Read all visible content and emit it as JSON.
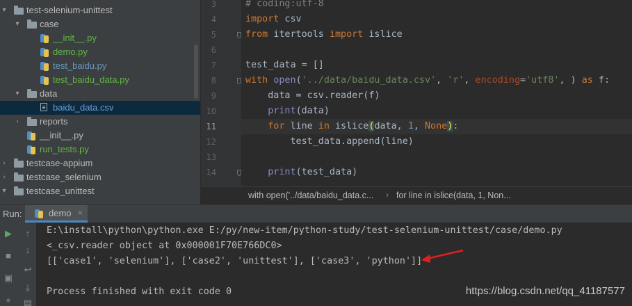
{
  "project_tree": [
    {
      "label": "test-selenium-unittest",
      "kind": "folder",
      "depth": 0,
      "expanded": true
    },
    {
      "label": "case",
      "kind": "folder",
      "depth": 1,
      "expanded": true
    },
    {
      "label": "__init__.py",
      "kind": "python",
      "depth": 2,
      "color": "green"
    },
    {
      "label": "demo.py",
      "kind": "python",
      "depth": 2,
      "color": "green"
    },
    {
      "label": "test_baidu.py",
      "kind": "python",
      "depth": 2,
      "color": "blue"
    },
    {
      "label": "test_baidu_data.py",
      "kind": "python",
      "depth": 2,
      "color": "green"
    },
    {
      "label": "data",
      "kind": "folder",
      "depth": 1,
      "expanded": true
    },
    {
      "label": "baidu_data.csv",
      "kind": "csv",
      "depth": 2,
      "color": "modified",
      "selected": true
    },
    {
      "label": "reports",
      "kind": "folder",
      "depth": 1,
      "expanded": false
    },
    {
      "label": "__init__.py",
      "kind": "python",
      "depth": 1,
      "color": "default"
    },
    {
      "label": "run_tests.py",
      "kind": "python",
      "depth": 1,
      "color": "green"
    },
    {
      "label": "testcase-appium",
      "kind": "folder",
      "depth": 0,
      "expanded": false
    },
    {
      "label": "testcase_selenium",
      "kind": "folder",
      "depth": 0,
      "expanded": false
    },
    {
      "label": "testcase_unittest",
      "kind": "folder",
      "depth": 0,
      "expanded": true
    }
  ],
  "editor": {
    "current_line": "11",
    "lines": [
      {
        "n": "3",
        "tokens": [
          {
            "t": "# coding:utf-8",
            "c": "cm"
          }
        ]
      },
      {
        "n": "4",
        "tokens": [
          {
            "t": "import",
            "c": "kw"
          },
          {
            "t": " csv",
            "c": ""
          }
        ]
      },
      {
        "n": "5",
        "tokens": [
          {
            "t": "from",
            "c": "kw"
          },
          {
            "t": " itertools ",
            "c": ""
          },
          {
            "t": "import",
            "c": "kw"
          },
          {
            "t": " islice",
            "c": ""
          }
        ]
      },
      {
        "n": "6",
        "tokens": []
      },
      {
        "n": "7",
        "tokens": [
          {
            "t": "test_data = []",
            "c": ""
          }
        ]
      },
      {
        "n": "8",
        "tokens": [
          {
            "t": "with",
            "c": "kw"
          },
          {
            "t": " ",
            "c": ""
          },
          {
            "t": "open",
            "c": "bi"
          },
          {
            "t": "(",
            "c": ""
          },
          {
            "t": "'../data/baidu_data.csv'",
            "c": "st"
          },
          {
            "t": ", ",
            "c": ""
          },
          {
            "t": "'r'",
            "c": "st"
          },
          {
            "t": ", ",
            "c": ""
          },
          {
            "t": "encoding",
            "c": "pa"
          },
          {
            "t": "=",
            "c": ""
          },
          {
            "t": "'utf8'",
            "c": "st"
          },
          {
            "t": ", ) ",
            "c": ""
          },
          {
            "t": "as",
            "c": "kw"
          },
          {
            "t": " f:",
            "c": ""
          }
        ]
      },
      {
        "n": "9",
        "tokens": [
          {
            "t": "    data = csv.reader(f)",
            "c": ""
          }
        ]
      },
      {
        "n": "10",
        "tokens": [
          {
            "t": "    ",
            "c": ""
          },
          {
            "t": "print",
            "c": "bi"
          },
          {
            "t": "(data)",
            "c": ""
          }
        ]
      },
      {
        "n": "11",
        "tokens": [
          {
            "t": "    ",
            "c": ""
          },
          {
            "t": "for",
            "c": "kw"
          },
          {
            "t": " line ",
            "c": ""
          },
          {
            "t": "in",
            "c": "kw"
          },
          {
            "t": " islice",
            "c": ""
          },
          {
            "t": "(",
            "c": "bm"
          },
          {
            "t": "data, ",
            "c": ""
          },
          {
            "t": "1",
            "c": "nm"
          },
          {
            "t": ", ",
            "c": ""
          },
          {
            "t": "None",
            "c": "kw"
          },
          {
            "t": ")",
            "c": "bm"
          },
          {
            "t": ":",
            "c": ""
          }
        ]
      },
      {
        "n": "12",
        "tokens": [
          {
            "t": "        test_data.append(line)",
            "c": ""
          }
        ]
      },
      {
        "n": "13",
        "tokens": []
      },
      {
        "n": "14",
        "tokens": [
          {
            "t": "    ",
            "c": ""
          },
          {
            "t": "print",
            "c": "bi"
          },
          {
            "t": "(test_data)",
            "c": ""
          }
        ]
      }
    ]
  },
  "breadcrumb": [
    "with open('../data/baidu_data.c...",
    "for line in islice(data, 1, Non..."
  ],
  "run": {
    "title": "Run:",
    "tab_label": "demo",
    "tab_close": "×",
    "console": [
      "E:\\install\\python\\python.exe E:/py/new-item/python-study/test-selenium-unittest/case/demo.py",
      "<_csv.reader object at 0x000001F70E766DC0>",
      "[['case1', 'selenium'], ['case2', 'unittest'], ['case3', 'python']]",
      "",
      "Process finished with exit code 0"
    ]
  },
  "watermark": "https://blog.csdn.net/qq_41187577",
  "colors": {
    "accent": "#4a88c7",
    "annotation_arrow": "#e0201c"
  }
}
